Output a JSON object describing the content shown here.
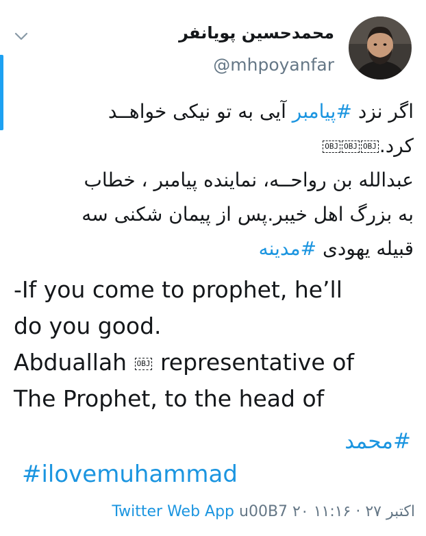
{
  "author": {
    "name": "محمدحسین پویانفر",
    "handle": "@mhpoyanfar"
  },
  "icons": {
    "menu": "chevron-down-icon"
  },
  "tweet": {
    "fa_lines": [
      {
        "before": "اگر نزد ",
        "tag": "#پیامبر",
        "after": " آیی به تو نیکی خواهــد"
      },
      {
        "text": "کرد."
      },
      {
        "text": "عبدالله بن رواحــه، نماینده پیامبر ، خطاب"
      },
      {
        "text": "به بزرگ اهل خیبر.پس از پیمان شکنی سه"
      },
      {
        "before": "قبیله یهودی ",
        "tag": "#مدینه"
      }
    ],
    "obj_label": "OBJ",
    "en_lines": [
      "-If you come to prophet, he’ll",
      "do you good.",
      "Abduallah",
      "representative of",
      "The Prophet, to the head of"
    ],
    "hashtag_fa": "#محمد",
    "hashtag_en": "#ilovemuhammad"
  },
  "meta": {
    "source": "Twitter Web App",
    "escape": " u00B7",
    "datetime": " ۲۰ اکتبر ۲۷ · ۱۱:۱۶"
  },
  "colors": {
    "accent": "#1da1f2",
    "link": "#1b95e0",
    "text": "#14171a",
    "muted": "#657786"
  }
}
